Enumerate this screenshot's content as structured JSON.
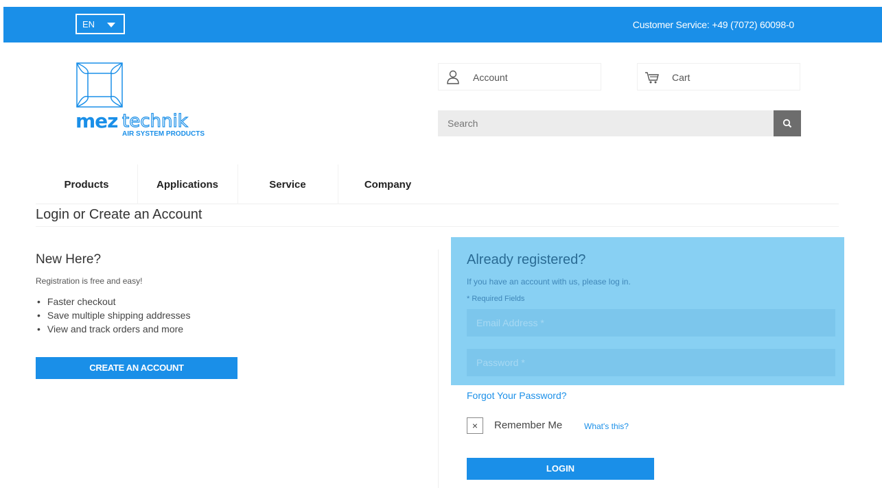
{
  "topbar": {
    "language": "EN",
    "customer_service": "Customer Service: +49 (7072) 60098-0"
  },
  "logo": {
    "brand_left": "mez",
    "brand_right": "technik",
    "tagline": "AIR SYSTEM PRODUCTS"
  },
  "header": {
    "account_label": "Account",
    "cart_label": "Cart",
    "search_placeholder": "Search"
  },
  "nav": {
    "items": [
      {
        "label": "Products"
      },
      {
        "label": "Applications"
      },
      {
        "label": "Service"
      },
      {
        "label": "Company"
      }
    ]
  },
  "page": {
    "title": "Login or Create an Account"
  },
  "new_customer": {
    "heading": "New Here?",
    "subtitle": "Registration is free and easy!",
    "benefits": [
      "Faster checkout",
      "Save multiple shipping addresses",
      "View and track orders and more"
    ],
    "create_button": "CREATE AN ACCOUNT"
  },
  "login": {
    "heading": "Already registered?",
    "subtitle": "If you have an account with us, please log in.",
    "required_note": "* Required Fields",
    "email_placeholder": "Email Address *",
    "password_placeholder": "Password *",
    "forgot_link": "Forgot Your Password?",
    "remember_mark": "×",
    "remember_label": "Remember Me",
    "whats_this": "What's this?",
    "login_button": "LOGIN"
  },
  "colors": {
    "brand_blue": "#1a8fe8",
    "panel_blue": "#88d0f3",
    "search_button": "#6d6d6d"
  },
  "icons": {
    "account": "user-icon",
    "cart": "cart-icon",
    "search": "search-icon",
    "language": "chevron-down-icon"
  }
}
